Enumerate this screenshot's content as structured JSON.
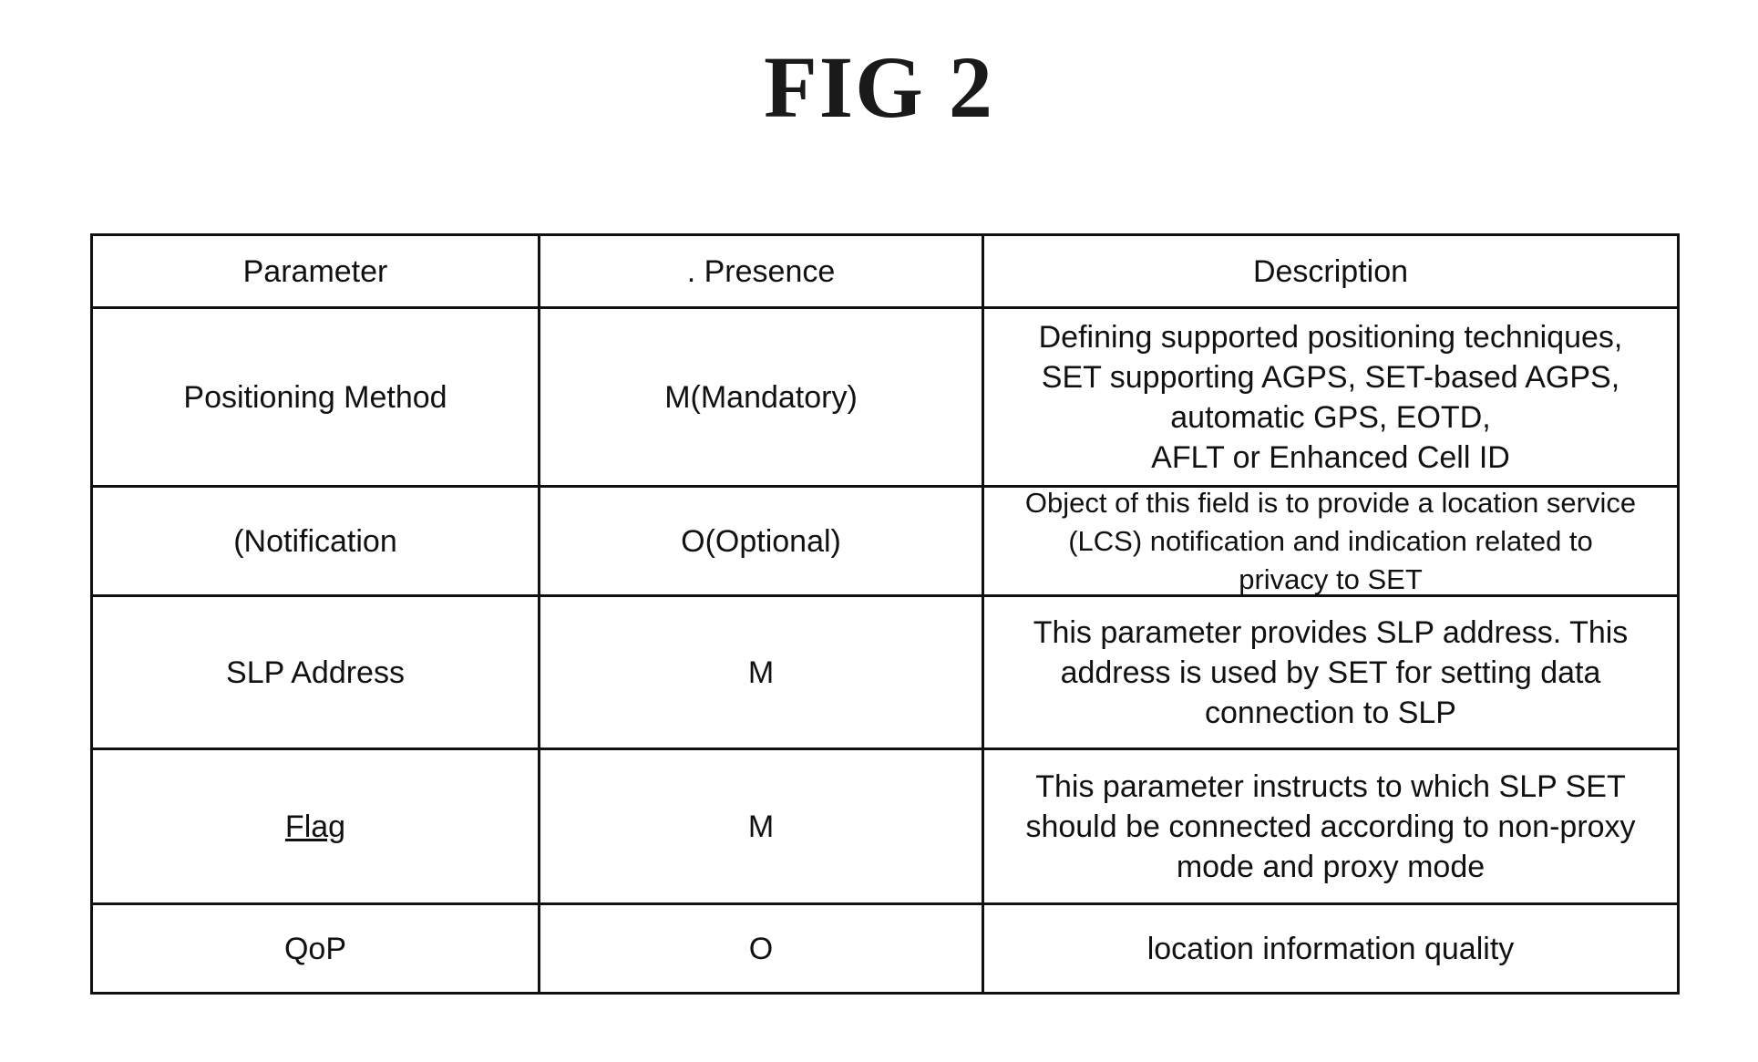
{
  "figure": {
    "title": "FIG 2"
  },
  "table": {
    "headers": {
      "parameter": "Parameter",
      "presence": ". Presence",
      "description": "Description"
    },
    "rows": [
      {
        "parameter": "Positioning Method",
        "presence": "M(Mandatory)",
        "description": "Defining supported positioning techniques,\nSET supporting AGPS, SET-based AGPS,\nautomatic GPS, EOTD,\nAFLT or Enhanced Cell ID"
      },
      {
        "parameter": "(Notification",
        "presence": "O(Optional)",
        "description": "Object of this field is to provide a location service\n(LCS) notification and indication related to\nprivacy to SET"
      },
      {
        "parameter": "SLP Address",
        "presence": "M",
        "description": "This parameter provides SLP address. This\naddress is used by SET for setting data\nconnection to SLP"
      },
      {
        "parameter": "Flag",
        "presence": "M",
        "description": "This parameter instructs to which SLP SET\nshould be connected according to non-proxy\nmode and proxy mode"
      },
      {
        "parameter": "QoP",
        "presence": "O",
        "description": "location information quality"
      }
    ]
  }
}
